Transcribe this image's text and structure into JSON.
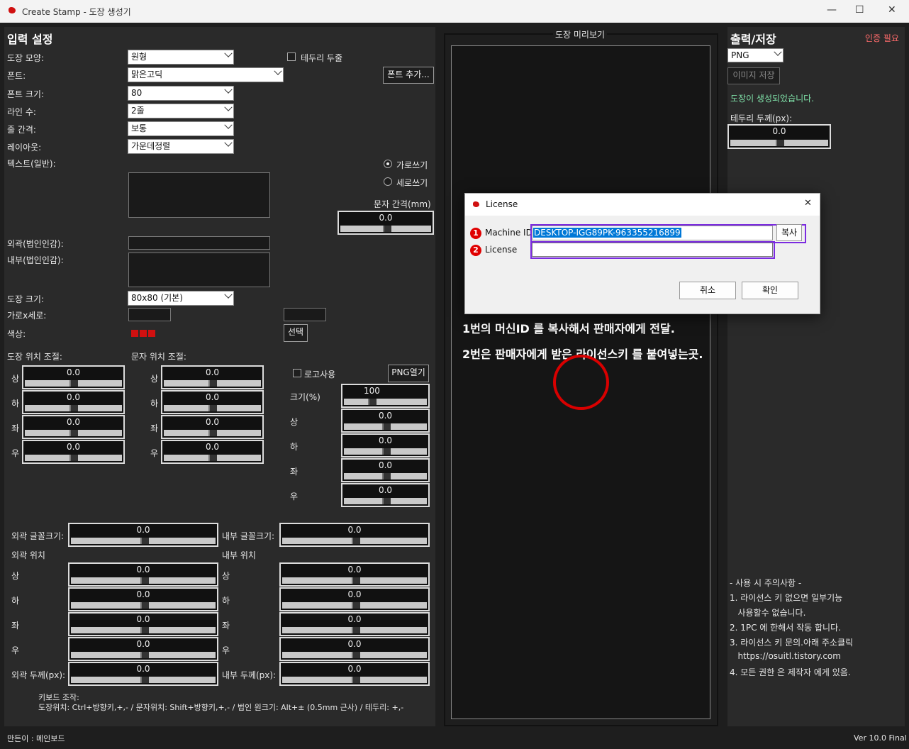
{
  "window": {
    "title": "Create Stamp - 도장 생성기",
    "min": "—",
    "max": "☐",
    "close": "✕"
  },
  "left": {
    "heading": "입력 설정",
    "shape_label": "도장 모양:",
    "shape_value": "원형",
    "border_double_label": "테두리 두줄",
    "font_label": "폰트:",
    "font_value": "맑은고딕",
    "font_add": "폰트 추가...",
    "font_size_label": "폰트 크기:",
    "font_size_value": "80",
    "lines_label": "라인 수:",
    "lines_value": "2줄",
    "spacing_label": "줄 간격:",
    "spacing_value": "보통",
    "layout_label": "레이아웃:",
    "layout_value": "가운데정렬",
    "text_label": "텍스트(일반):",
    "horizontal": "가로쓰기",
    "vertical": "세로쓰기",
    "char_spacing_label": "문자 간격(mm)",
    "char_spacing_value": "0.0",
    "outer_label": "외곽(법인인감):",
    "inner_label": "내부(법인인감):",
    "stamp_size_label": "도장 크기:",
    "stamp_size_value": "80x80 (기본)",
    "wh_label": "가로x세로:",
    "color_label": "색상:",
    "color_select": "선택",
    "stamp_pos_label": "도장 위치 조절:",
    "text_pos_label": "문자 위치 조절:",
    "dirs": [
      "상",
      "하",
      "좌",
      "우"
    ],
    "stamp_pos": [
      "0.0",
      "0.0",
      "0.0",
      "0.0"
    ],
    "text_pos": [
      "0.0",
      "0.0",
      "0.0",
      "0.0"
    ],
    "logo_use": "로고사용",
    "png_open": "PNG열기",
    "logo_size_label": "크기(%)",
    "logo_size_value": "100",
    "logo_pos": [
      "0.0",
      "0.0",
      "0.0",
      "0.0"
    ],
    "outer_font_label": "외곽 글꼴크기:",
    "outer_font_value": "0.0",
    "inner_font_label": "내부 글꼴크기:",
    "inner_font_value": "0.0",
    "outer_pos_label": "외곽 위치",
    "inner_pos_label": "내부 위치",
    "outer_pos": [
      "0.0",
      "0.0",
      "0.0",
      "0.0"
    ],
    "inner_pos": [
      "0.0",
      "0.0",
      "0.0",
      "0.0"
    ],
    "outer_thick_label": "외곽 두께(px):",
    "outer_thick_value": "0.0",
    "inner_thick_label": "내부 두께(px):",
    "inner_thick_value": "0.0",
    "keyboard_title": "키보드 조작:",
    "keyboard_text": "도장위치: Ctrl+방향키,+,- / 문자위치: Shift+방향키,+,- / 법인 원크기: Alt+± (0.5mm 근사) / 테두리: +,-"
  },
  "preview": {
    "title": "도장 미리보기"
  },
  "right": {
    "heading": "출력/저장",
    "auth_needed": "인증 필요",
    "format_value": "PNG",
    "save_image": "이미지 저장",
    "status": "도장이 생성되었습니다.",
    "border_thick_label": "테두리 두께(px):",
    "border_thick_value": "0.0",
    "notes_title": "- 사용 시 주의사항 -",
    "notes": [
      "1. 라이선스 키 없으면 일부기능",
      "   사용할수 없습니다.",
      "2. 1PC 에 한해서 작동 합니다.",
      "3. 라이선스 키 문의.아래 주소클릭",
      "   https://osuitl.tistory.com",
      "4. 모든 권한 은 제작자 에게 있음."
    ]
  },
  "dialog": {
    "title": "License",
    "close": "✕",
    "machine_label": "Machine ID",
    "machine_value": "DESKTOP-IGG89PK-963355216899",
    "copy": "복사",
    "license_label": "License",
    "license_value": "",
    "cancel": "취소",
    "ok": "확인",
    "num1": "1",
    "num2": "2"
  },
  "annotation": {
    "line1": "1번의 머신ID 를 복사해서 판매자에게 전달.",
    "line2": "2번은 판매자에게 받은 라이선스키 를 붙여넣는곳."
  },
  "footer": {
    "maker": "만든이 : 메인보드",
    "version": "Ver 10.0 Final"
  },
  "colors": {
    "red": "#d01010",
    "status_green": "#7fe0a8",
    "auth_red": "#ff6b6b",
    "dialog_highlight": "#7b2be0",
    "selection_blue": "#0078d7"
  }
}
